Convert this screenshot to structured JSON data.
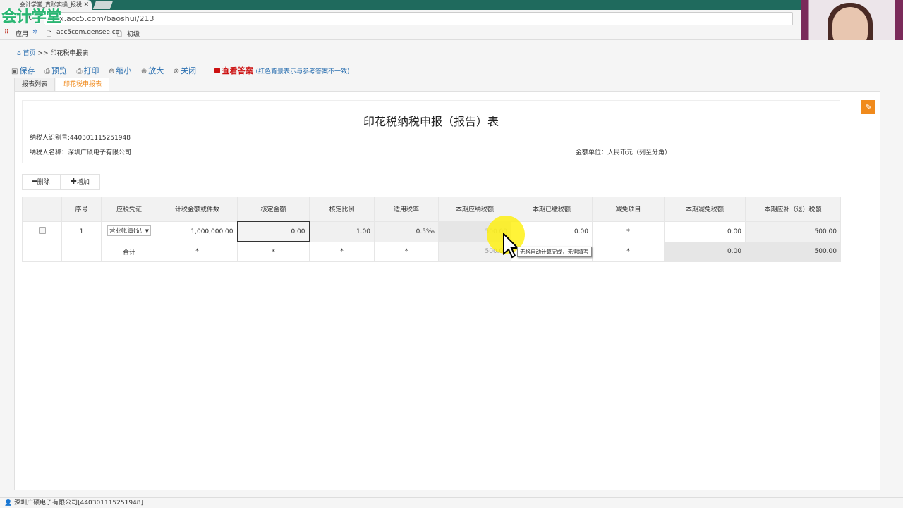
{
  "browser": {
    "tab_title": "会计学堂_真账实操_报税",
    "url": "lx.acc5.com/baoshui/213",
    "bookmarks": [
      "应用",
      "acc5com.gensee.co",
      "初级"
    ]
  },
  "logo_text": "会计学堂",
  "breadcrumb": {
    "home": "首页",
    "current": ">> 印花税申报表"
  },
  "toolbar": {
    "save": "保存",
    "preview": "预览",
    "print": "打印",
    "zoom_out": "缩小",
    "zoom_in": "放大",
    "close": "关闭",
    "view_answer": "查看答案",
    "answer_note": "(红色背景表示与参考答案不一致)"
  },
  "tabs": [
    "报表列表",
    "印花税申报表"
  ],
  "form": {
    "title": "印花税纳税申报（报告）表",
    "taxpayer_id_label": "纳税人识别号:440301115251948",
    "taxpayer_name_label": "纳税人名称：深圳广硕电子有限公司",
    "currency_unit": "金额单位：人民币元（列至分角）"
  },
  "actions": {
    "delete": "删除",
    "add": "增加"
  },
  "table": {
    "headers": [
      "",
      "序号",
      "应税凭证",
      "计税金额或件数",
      "核定金额",
      "核定比例",
      "适用税率",
      "本期应纳税额",
      "本期已缴税额",
      "减免项目",
      "本期减免税额",
      "本期应补（退）税额"
    ],
    "row": {
      "seq": "1",
      "voucher": "营业帐簿(记",
      "taxable_amount": "1,000,000.00",
      "approved_amount": "0.00",
      "approved_ratio": "1.00",
      "rate": "0.5‰",
      "payable": "500.00",
      "paid": "0.00",
      "exempt_item": "*",
      "exempt_amount": "0.00",
      "due": "500.00"
    },
    "total": {
      "label": "合计",
      "c3": "*",
      "c4": "*",
      "c5": "*",
      "c6": "*",
      "payable": "500.00",
      "exempt_item": "*",
      "exempt_amount": "0.00",
      "due": "500.00"
    }
  },
  "tooltip": "无格自动计算完成，无需填写",
  "status": "深圳广硕电子有限公司[440301115251948]"
}
